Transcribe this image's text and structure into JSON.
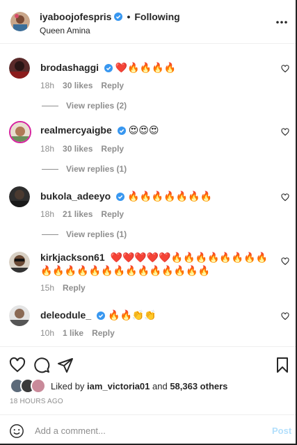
{
  "header": {
    "username": "iyaboojofespris",
    "dot": "•",
    "follow_state": "Following",
    "subtitle": "Queen Amina",
    "verified": true
  },
  "comments": [
    {
      "username": "brodashaggi",
      "verified": true,
      "text": "❤️🔥🔥🔥🔥",
      "time": "18h",
      "likes": "30 likes",
      "reply": "Reply",
      "view_replies": "View replies (2)"
    },
    {
      "username": "realmercyaigbe",
      "verified": true,
      "text": "😍😍😍",
      "time": "18h",
      "likes": "30 likes",
      "reply": "Reply",
      "view_replies": "View replies (1)"
    },
    {
      "username": "bukola_adeeyo",
      "verified": true,
      "text": "🔥🔥🔥🔥🔥🔥🔥",
      "time": "18h",
      "likes": "21 likes",
      "reply": "Reply",
      "view_replies": "View replies (1)"
    },
    {
      "username": "kirkjackson61",
      "verified": false,
      "text": "❤️❤️❤️❤️❤️🔥🔥🔥🔥🔥🔥🔥🔥🔥🔥🔥🔥🔥🔥🔥🔥🔥🔥🔥🔥🔥🔥",
      "time": "15h",
      "reply": "Reply"
    },
    {
      "username": "deleodule_",
      "verified": true,
      "text": "🔥🔥👏👏",
      "time": "10h",
      "likes": "1 like",
      "reply": "Reply"
    }
  ],
  "liked_by": {
    "prefix": "Liked by ",
    "user": "iam_victoria01",
    "middle": " and ",
    "count": "58,363 others"
  },
  "timestamp": "18 HOURS AGO",
  "add_comment": {
    "placeholder": "Add a comment...",
    "post_label": "Post"
  },
  "colors": {
    "verified": "#3897f0",
    "muted": "#8e8e8e",
    "post_disabled": "#b2dffc"
  }
}
